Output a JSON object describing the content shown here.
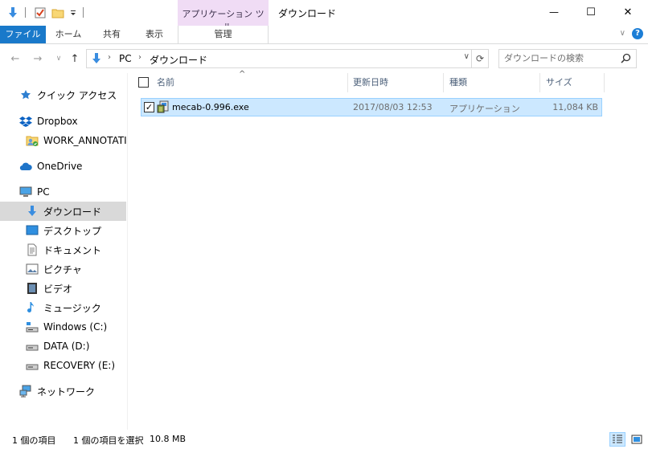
{
  "titlebar": {
    "context_tab_group": "アプリケーション ツール",
    "window_title": "ダウンロード",
    "minimize_glyph": "—",
    "maximize_glyph": "☐",
    "close_glyph": "✕"
  },
  "ribbon": {
    "tabs": [
      {
        "label": "ファイル"
      },
      {
        "label": "ホーム"
      },
      {
        "label": "共有"
      },
      {
        "label": "表示"
      },
      {
        "label": "管理"
      }
    ],
    "expand_glyph": "∨",
    "help_glyph": "?"
  },
  "navigation": {
    "back_glyph": "←",
    "forward_glyph": "→",
    "recent_glyph": "∨",
    "up_glyph": "↑",
    "breadcrumb": [
      "PC",
      "ダウンロード"
    ],
    "breadcrumb_sep": "›",
    "dropdown_glyph": "∨",
    "refresh_glyph": "⟳"
  },
  "search": {
    "placeholder": "ダウンロードの検索"
  },
  "nav_pane": {
    "items": [
      {
        "label": "クイック アクセス",
        "icon": "star-icon"
      },
      {
        "label": "Dropbox",
        "icon": "dropbox-icon"
      },
      {
        "label": "WORK_ANNOTATIC",
        "icon": "shared-folder-icon"
      },
      {
        "label": "OneDrive",
        "icon": "cloud-icon"
      },
      {
        "label": "PC",
        "icon": "computer-icon"
      },
      {
        "label": "ダウンロード",
        "icon": "download-arrow-icon"
      },
      {
        "label": "デスクトップ",
        "icon": "desktop-icon"
      },
      {
        "label": "ドキュメント",
        "icon": "document-icon"
      },
      {
        "label": "ピクチャ",
        "icon": "picture-icon"
      },
      {
        "label": "ビデオ",
        "icon": "video-icon"
      },
      {
        "label": "ミュージック",
        "icon": "music-icon"
      },
      {
        "label": "Windows (C:)",
        "icon": "windows-drive-icon"
      },
      {
        "label": "DATA (D:)",
        "icon": "drive-icon"
      },
      {
        "label": "RECOVERY (E:)",
        "icon": "drive-icon"
      },
      {
        "label": "ネットワーク",
        "icon": "network-icon"
      }
    ],
    "selected": "ダウンロード"
  },
  "columns": {
    "name": "名前",
    "date": "更新日時",
    "type": "種類",
    "size": "サイズ",
    "sort_glyph": "^"
  },
  "files": [
    {
      "name": "mecab-0.996.exe",
      "date": "2017/08/03 12:53",
      "type": "アプリケーション",
      "size": "11,084 KB",
      "checked_glyph": "✓",
      "icon": "installer-icon"
    }
  ],
  "statusbar": {
    "item_count": "1 個の項目",
    "selected_info": "1 個の項目を選択",
    "selected_size": "10.8 MB"
  },
  "colors": {
    "file_tab": "#1979ca",
    "context_tab": "#f0dcf5",
    "selection": "#cce8ff",
    "selection_border": "#99d1ff",
    "nav_selected": "#d9d9d9"
  }
}
